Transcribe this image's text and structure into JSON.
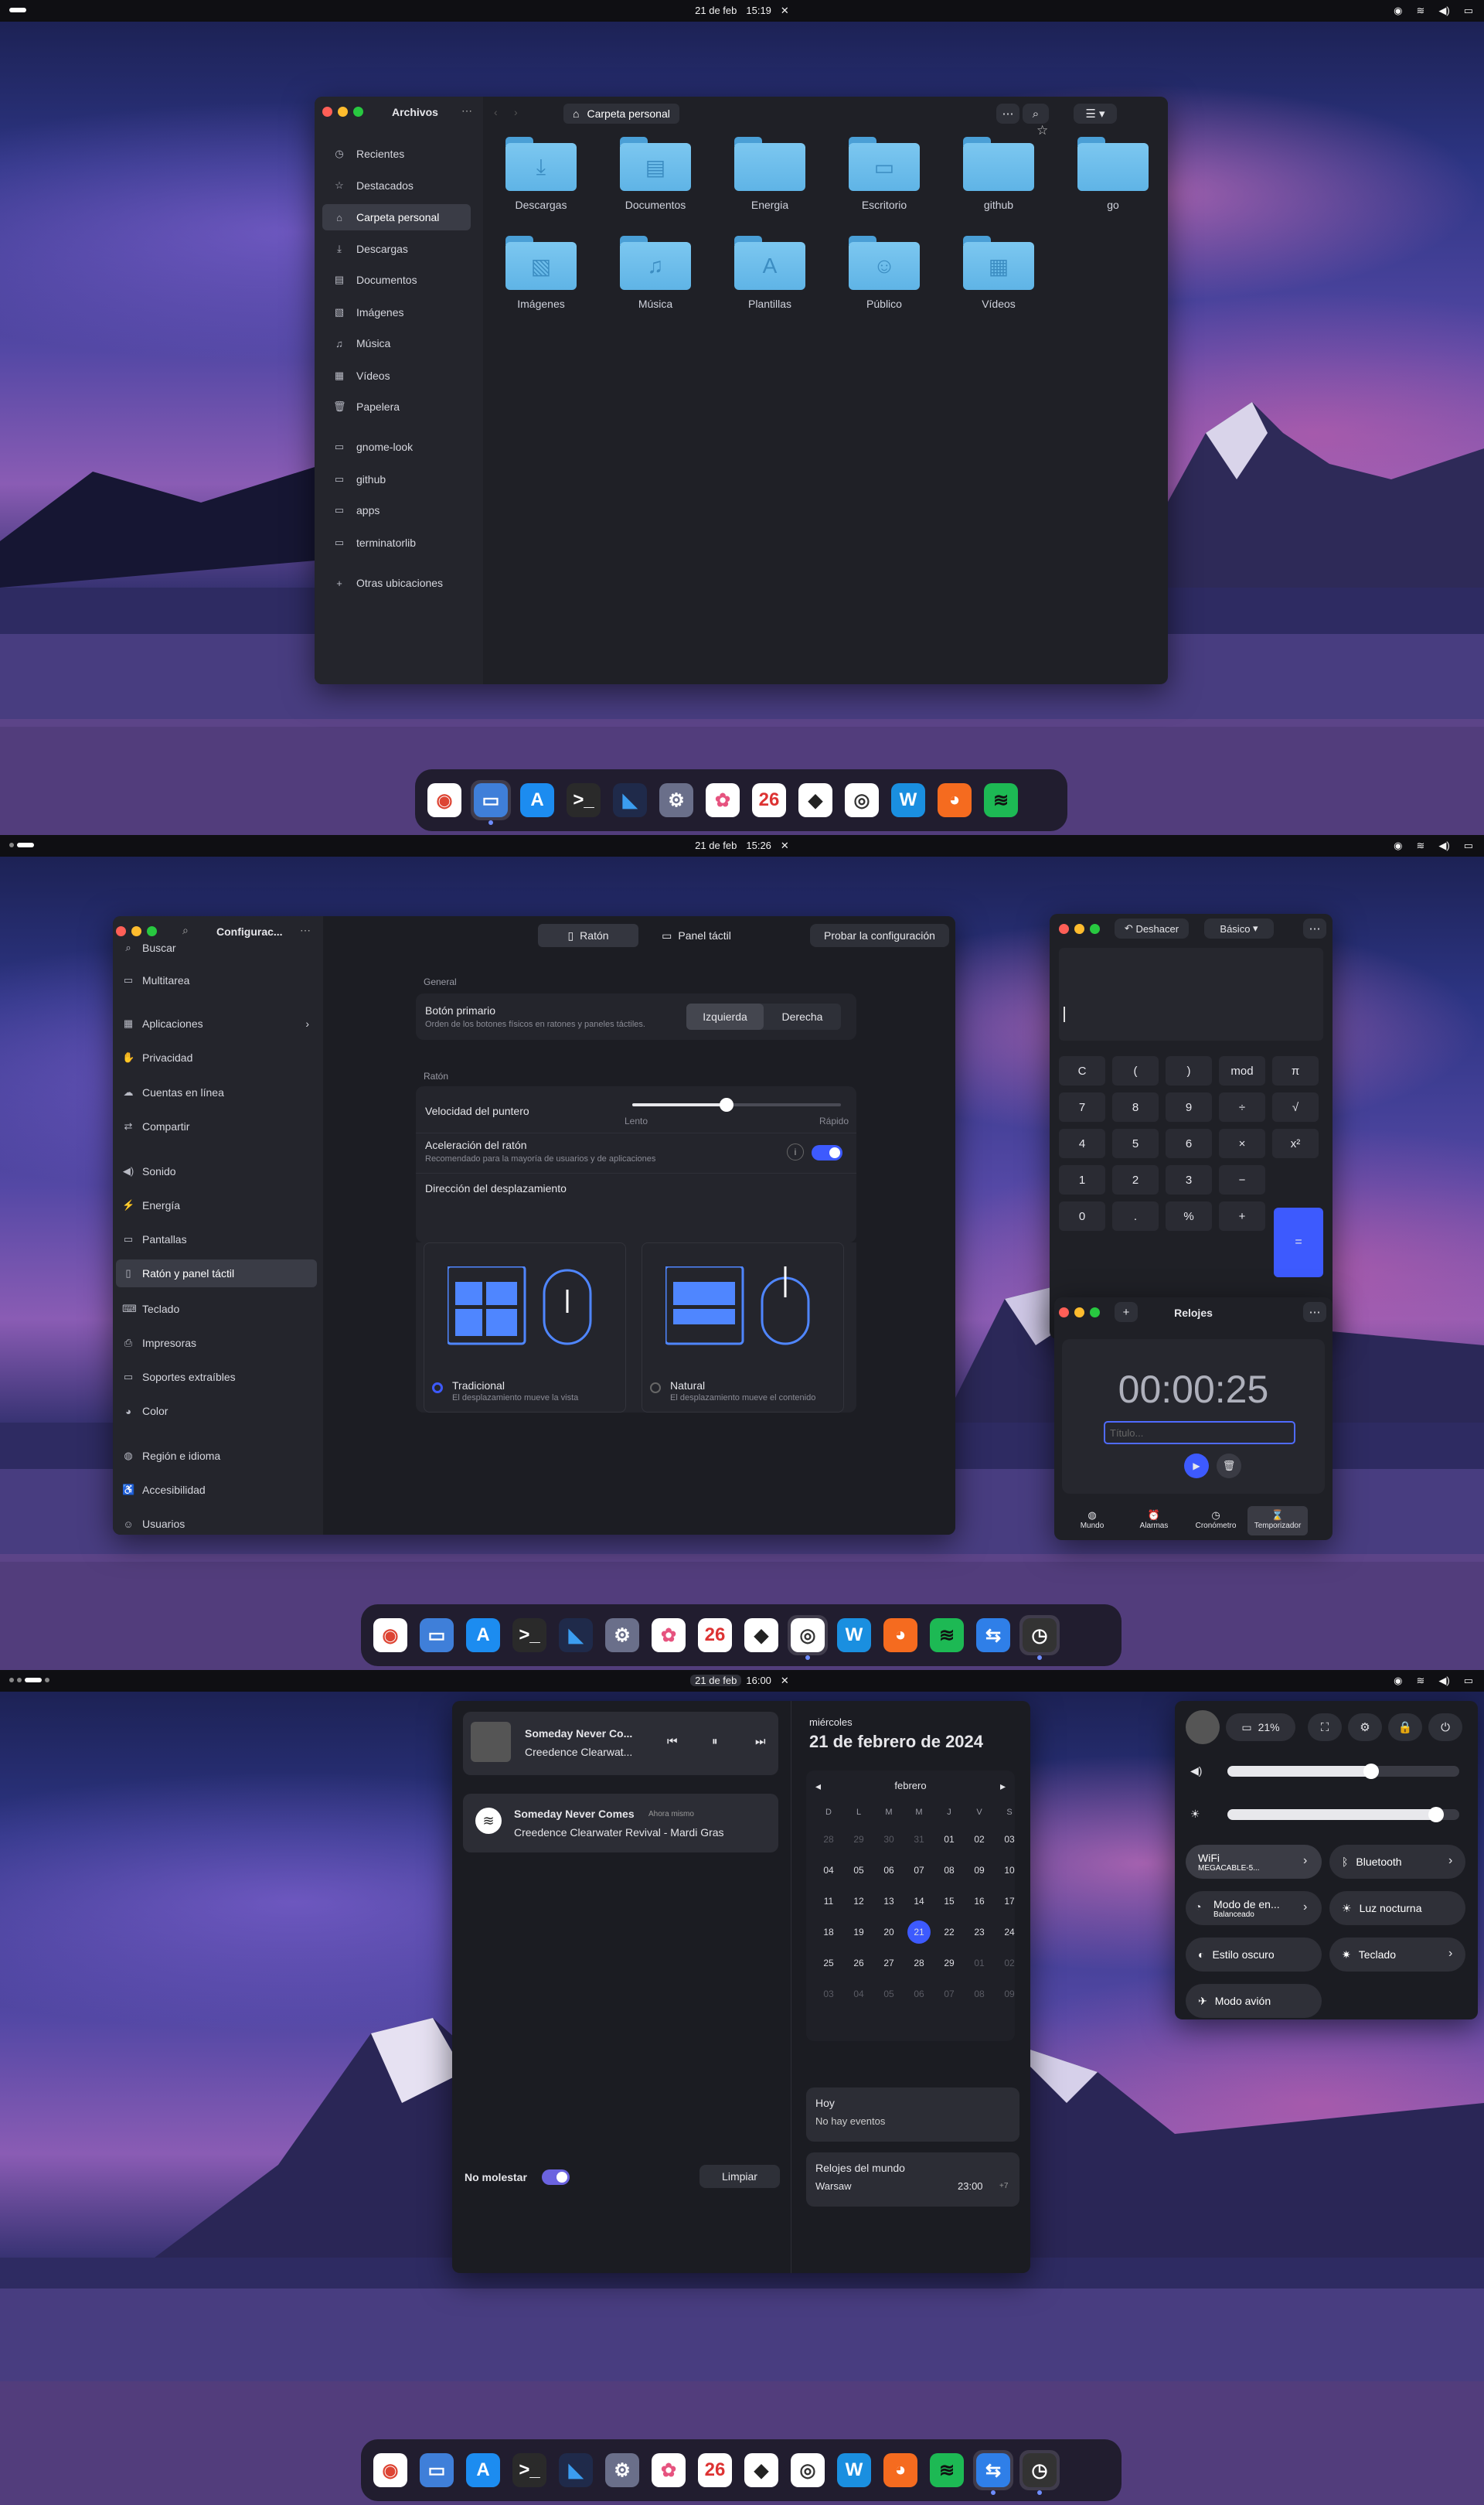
{
  "screens": [
    {
      "topbar": {
        "date": "21 de feb",
        "time": "15:19"
      }
    },
    {
      "topbar": {
        "date": "21 de feb",
        "time": "15:26"
      }
    },
    {
      "topbar": {
        "date": "21 de feb",
        "time": "16:00"
      }
    }
  ],
  "files": {
    "title": "Archivos",
    "path": "Carpeta personal",
    "sidebar": [
      {
        "label": "Recientes",
        "icon": "clock-icon"
      },
      {
        "label": "Destacados",
        "icon": "star-icon"
      },
      {
        "label": "Carpeta personal",
        "icon": "home-icon"
      },
      {
        "label": "Descargas",
        "icon": "download-icon"
      },
      {
        "label": "Documentos",
        "icon": "document-icon"
      },
      {
        "label": "Imágenes",
        "icon": "image-icon"
      },
      {
        "label": "Música",
        "icon": "music-icon"
      },
      {
        "label": "Vídeos",
        "icon": "video-icon"
      },
      {
        "label": "Papelera",
        "icon": "trash-icon"
      },
      {
        "label": "gnome-look",
        "icon": "folder-icon"
      },
      {
        "label": "github",
        "icon": "folder-icon"
      },
      {
        "label": "apps",
        "icon": "folder-icon"
      },
      {
        "label": "terminatorlib",
        "icon": "folder-icon"
      },
      {
        "label": "Otras ubicaciones",
        "icon": "plus-icon"
      }
    ],
    "folders": [
      {
        "label": "Descargas",
        "glyph": "⤓"
      },
      {
        "label": "Documentos",
        "glyph": "▤"
      },
      {
        "label": "Energia",
        "glyph": ""
      },
      {
        "label": "Escritorio",
        "glyph": "▭"
      },
      {
        "label": "github",
        "glyph": ""
      },
      {
        "label": "go",
        "glyph": ""
      },
      {
        "label": "Imágenes",
        "glyph": "▧"
      },
      {
        "label": "Música",
        "glyph": "♫"
      },
      {
        "label": "Plantillas",
        "glyph": "A"
      },
      {
        "label": "Público",
        "glyph": "☺"
      },
      {
        "label": "Vídeos",
        "glyph": "▦"
      }
    ]
  },
  "settings": {
    "title": "Configurac...",
    "tabs": [
      "Ratón",
      "Panel táctil"
    ],
    "test_button": "Probar la configuración",
    "sidebar": [
      "Buscar",
      "Multitarea",
      "Aplicaciones",
      "Privacidad",
      "Cuentas en línea",
      "Compartir",
      "Sonido",
      "Energía",
      "Pantallas",
      "Ratón y panel táctil",
      "Teclado",
      "Impresoras",
      "Soportes extraíbles",
      "Color",
      "Región e idioma",
      "Accesibilidad",
      "Usuarios"
    ],
    "general_header": "General",
    "primary_button_label": "Botón primario",
    "primary_button_desc": "Orden de los botones físicos en ratones y paneles táctiles.",
    "left": "Izquierda",
    "right": "Derecha",
    "mouse_header": "Ratón",
    "pointer_speed": "Velocidad del puntero",
    "slow": "Lento",
    "fast": "Rápido",
    "pointer_speed_value": 0.45,
    "accel_label": "Aceleración del ratón",
    "accel_desc": "Recomendado para la mayoría de usuarios y de aplicaciones",
    "scroll_dir": "Dirección del desplazamiento",
    "traditional": "Tradicional",
    "traditional_desc": "El desplazamiento mueve la vista",
    "natural": "Natural",
    "natural_desc": "El desplazamiento mueve el contenido"
  },
  "calculator": {
    "undo": "Deshacer",
    "mode": "Básico",
    "keys": [
      [
        "C",
        "(",
        ")",
        "mod",
        "π"
      ],
      [
        "7",
        "8",
        "9",
        "÷",
        "√"
      ],
      [
        "4",
        "5",
        "6",
        "×",
        "x²"
      ],
      [
        "1",
        "2",
        "3",
        "−"
      ],
      [
        "0",
        ".",
        "%",
        "+"
      ]
    ],
    "equals": "="
  },
  "clocks": {
    "title": "Relojes",
    "timer": "00:00:25",
    "placeholder": "Título...",
    "tabs": [
      "Mundo",
      "Alarmas",
      "Cronómetro",
      "Temporizador"
    ]
  },
  "notifications": {
    "media_title": "Someday Never Co...",
    "media_artist": "Creedence Clearwat...",
    "notif_title": "Someday Never Comes",
    "notif_time": "Ahora mismo",
    "notif_body": "Creedence Clearwater Revival - Mardi Gras",
    "dnd": "No molestar",
    "clear": "Limpiar",
    "weekday": "miércoles",
    "date": "21 de febrero de 2024",
    "month": "febrero",
    "dow": [
      "D",
      "L",
      "M",
      "M",
      "J",
      "V",
      "S"
    ],
    "weeks": [
      [
        "28",
        "29",
        "30",
        "31",
        "01",
        "02",
        "03"
      ],
      [
        "04",
        "05",
        "06",
        "07",
        "08",
        "09",
        "10"
      ],
      [
        "11",
        "12",
        "13",
        "14",
        "15",
        "16",
        "17"
      ],
      [
        "18",
        "19",
        "20",
        "21",
        "22",
        "23",
        "24"
      ],
      [
        "25",
        "26",
        "27",
        "28",
        "29",
        "01",
        "02"
      ],
      [
        "03",
        "04",
        "05",
        "06",
        "07",
        "08",
        "09"
      ]
    ],
    "today_label": "Hoy",
    "no_events": "No hay eventos",
    "world_clocks": "Relojes del mundo",
    "city": "Warsaw",
    "city_time": "23:00",
    "offset": "+7"
  },
  "quick": {
    "battery": "21%",
    "wifi": "WiFi",
    "wifi_sub": "MEGACABLE-5...",
    "bluetooth": "Bluetooth",
    "power_mode": "Modo de en...",
    "power_sub": "Balanceado",
    "night": "Luz nocturna",
    "dark": "Estilo oscuro",
    "keyboard": "Teclado",
    "airplane": "Modo avión",
    "volume": 0.62,
    "brightness": 0.9
  },
  "colors": {
    "accent": "#3d5afe",
    "folder": "#6cbdec"
  }
}
